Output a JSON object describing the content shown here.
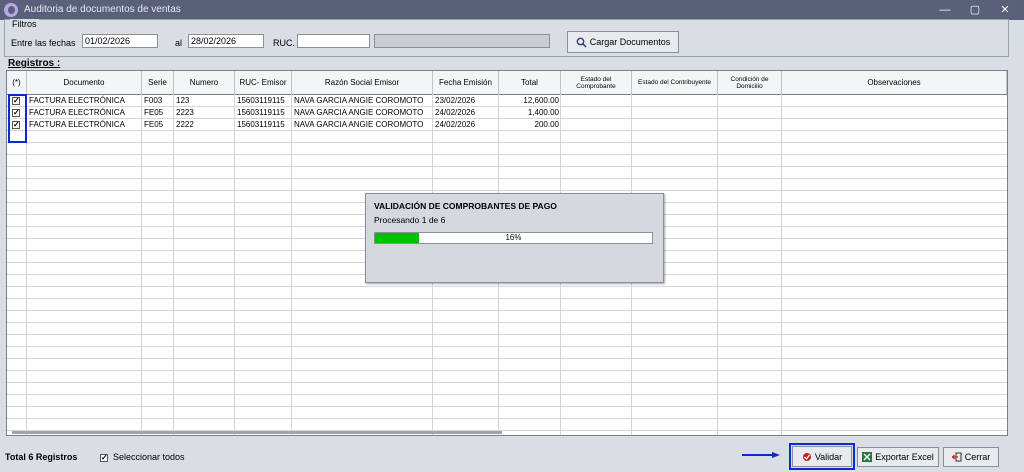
{
  "window": {
    "title": "Auditoria de documentos  de ventas",
    "minimize": "—",
    "maximize": "▢",
    "close": "✕"
  },
  "filters": {
    "legend": "Filtros",
    "between_label": "Entre las fechas",
    "date_from": "01/02/2026",
    "to_label": "al",
    "date_to": "28/02/2026",
    "ruc_label": "RUC.",
    "ruc_value": "",
    "name_value": "",
    "load_button": "Cargar Documentos"
  },
  "registros_label": "Registros  :",
  "columns": [
    "(*)",
    "Documento",
    "Serie",
    "Numero",
    "RUC- Emisor",
    "Razón Social Emisor",
    "Fecha Emisión",
    "Total",
    "Estado del Comprobante",
    "Estado del Contribuyente",
    "Condición de Domicilio",
    "Observaciones"
  ],
  "rows": [
    {
      "checked": true,
      "documento": "FACTURA ELECTRÓNICA",
      "serie": "F003",
      "numero": "123",
      "ruc": "15603119115",
      "razon": "NAVA GARCIA ANGIE COROMOTO",
      "fecha": "23/02/2026",
      "total": "12,600.00"
    },
    {
      "checked": true,
      "documento": "FACTURA ELECTRÓNICA",
      "serie": "FE05",
      "numero": "2223",
      "ruc": "15603119115",
      "razon": "NAVA GARCIA ANGIE COROMOTO",
      "fecha": "24/02/2026",
      "total": "1,400.00"
    },
    {
      "checked": true,
      "documento": "FACTURA ELECTRÓNICA",
      "serie": "FE05",
      "numero": "2222",
      "ruc": "15603119115",
      "razon": "NAVA GARCIA ANGIE COROMOTO",
      "fecha": "24/02/2026",
      "total": "200.00"
    }
  ],
  "dialog": {
    "title": "VALIDACIÓN DE COMPROBANTES DE PAGO",
    "status": "Procesando 1 de 6",
    "progress_fraction": 0.16,
    "progress_text": "16%"
  },
  "footer": {
    "total_text": "Total 6 Registros",
    "select_all_label": "Seleccionar todos",
    "select_all_checked": true,
    "validate_button": "Validar",
    "export_button": "Exportar Excel",
    "close_button": "Cerrar"
  },
  "colors": {
    "title_bar": "#5a607a",
    "highlight": "#0a2ad8",
    "progress": "#00c000"
  }
}
